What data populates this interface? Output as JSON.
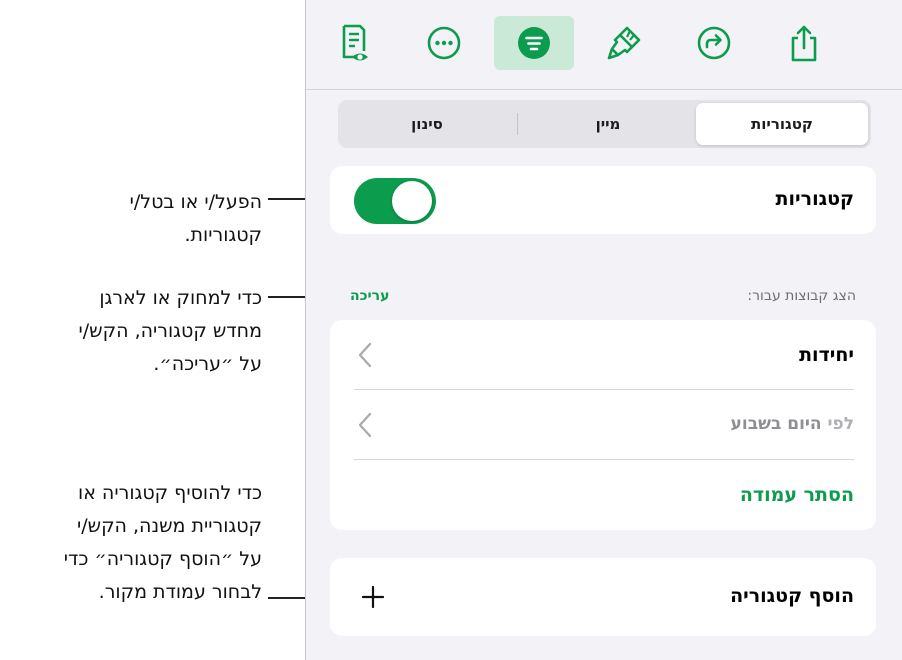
{
  "toolbar": {
    "items": [
      {
        "name": "reading-view-icon",
        "active": false
      },
      {
        "name": "more-icon",
        "active": false
      },
      {
        "name": "organize-icon",
        "active": true
      },
      {
        "name": "format-brush-icon",
        "active": false
      },
      {
        "name": "redo-icon",
        "active": false
      },
      {
        "name": "share-icon",
        "active": false
      }
    ]
  },
  "tabs": {
    "categories": "קטגוריות",
    "sort": "מיין",
    "filter": "סינון"
  },
  "categories_toggle": {
    "label": "קטגוריות",
    "enabled": true
  },
  "groups_section": {
    "label": "הצג קבוצות עבור:",
    "edit": "עריכה"
  },
  "group_rows": {
    "units": "יחידות",
    "by_weekday_prefix": "לפי ",
    "by_weekday": "היום בשבוע",
    "hide_column": "הסתר עמודה"
  },
  "add_category": {
    "label": "הוסף קטגוריה"
  },
  "callouts": {
    "toggle": [
      "הפעל/י או בטל/י",
      "קטגוריות."
    ],
    "edit": [
      "כדי למחוק או לארגן",
      "מחדש קטגוריה, הקש/י",
      "על ״עריכה״."
    ],
    "add": [
      "כדי להוסיף קטגוריה או",
      "קטגוריית משנה, הקש/י",
      "על ״הוסף קטגוריה״ כדי",
      "לבחור עמודת מקור."
    ]
  },
  "colors": {
    "accent": "#0c9c4e",
    "active_tab_bg": "#cbe9d7",
    "panel_bg": "#f2f2f7"
  }
}
